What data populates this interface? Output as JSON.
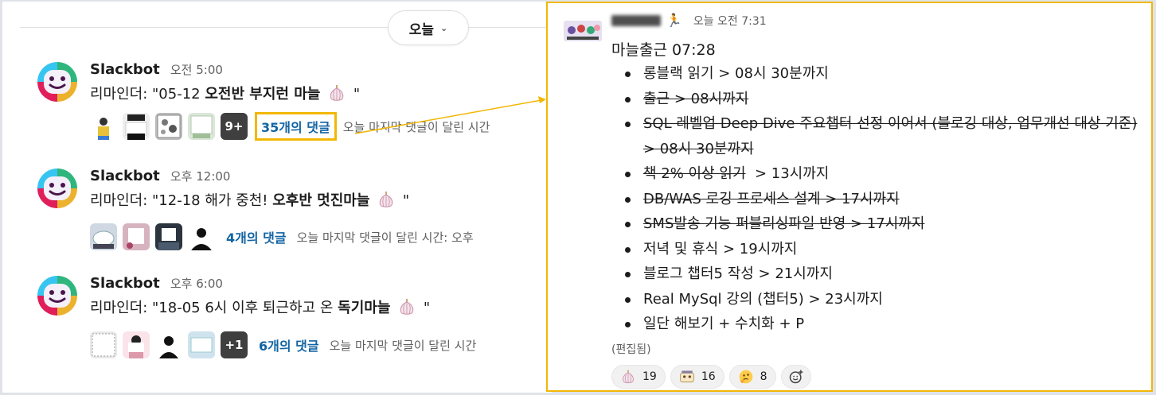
{
  "channel": {
    "day_divider": "오늘"
  },
  "messages": [
    {
      "sender": "Slackbot",
      "time": "오전 5:00",
      "text_prefix": "리마인더: \"05-12 ",
      "text_bold": "오전반 부지런 마늘",
      "text_suffix": " \"",
      "extra_avatar": "9+",
      "reply_count": "35개의 댓글",
      "last_reply": "오늘 마지막 댓글이 달린 시간"
    },
    {
      "sender": "Slackbot",
      "time": "오후 12:00",
      "text_prefix": "리마인더: \"12-18 해가 중천! ",
      "text_bold": "오후반 멋진마늘",
      "text_suffix": " \"",
      "extra_avatar": "",
      "reply_count": "4개의 댓글",
      "last_reply": "오늘 마지막 댓글이 달린 시간: 오후"
    },
    {
      "sender": "Slackbot",
      "time": "오후 6:00",
      "text_prefix": "리마인더: \"18-05 6시 이후 퇴근하고 온 ",
      "text_bold": "독기마늘",
      "text_suffix": " \"",
      "extra_avatar": "+1",
      "reply_count": "6개의 댓글",
      "last_reply": "오늘 마지막 댓글이 달린 시간"
    }
  ],
  "thread_message": {
    "time": "오늘 오전 7:31",
    "title": "마늘출근 07:28",
    "items": [
      {
        "text": "롱블랙 읽기 > 08시 30분까지",
        "done": false
      },
      {
        "text": "출근 > 08시까지",
        "done": true
      },
      {
        "text": "SQL 레벨업 Deep Dive 주요챕터 선정 이어서 (블로깅 대상, 업무개선 대상 기준) > 08시 30분까지",
        "done": true
      },
      {
        "text": "책 2% 이상 읽기 > 13시까지",
        "done": "partial",
        "struck": "책 2% 이상 읽기",
        "rest": "  > 13시까지"
      },
      {
        "text": "DB/WAS 로깅 프로세스 설계 > 17시까지",
        "done": true
      },
      {
        "text": "SMS발송 기능 퍼블리싱파일 반영 > 17시까지",
        "done": true
      },
      {
        "text": "저녁 및 휴식 > 19시까지",
        "done": false
      },
      {
        "text": "블로그 챕터5 작성 >  21시까지",
        "done": false
      },
      {
        "text": "Real MySql 강의 (챕터5) > 23시까지",
        "done": false
      },
      {
        "text": "일단 해보기 + 수치화 + P",
        "done": false
      }
    ],
    "edited": "(편집됨)",
    "reactions": [
      {
        "icon": "garlic-icon",
        "count": "19"
      },
      {
        "icon": "sticker-icon",
        "count": "16"
      },
      {
        "icon": "thinking-face-icon",
        "count": "8"
      }
    ]
  },
  "colors": {
    "highlight": "#f2b705",
    "link": "#1264a3",
    "muted": "#616061"
  }
}
